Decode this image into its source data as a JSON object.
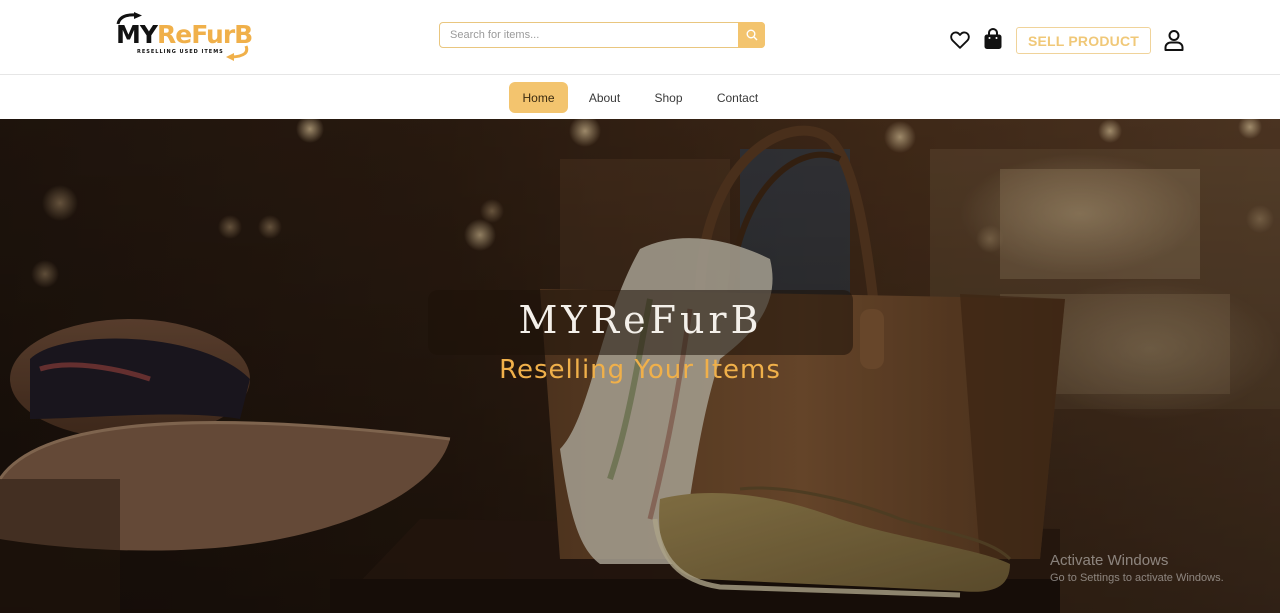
{
  "header": {
    "logo": {
      "text_my": "MY",
      "text_refurb": "ReFurB",
      "tagline": "RESELLING USED ITEMS"
    },
    "search": {
      "placeholder": "Search for items...",
      "value": "",
      "icon": "search-icon"
    },
    "wishlist_icon": "heart-icon",
    "cart_icon": "shopping-bag-icon",
    "sell_button_label": "SELL PRODUCT",
    "account_icon": "user-icon"
  },
  "nav": {
    "items": [
      {
        "label": "Home",
        "active": true
      },
      {
        "label": "About",
        "active": false
      },
      {
        "label": "Shop",
        "active": false
      },
      {
        "label": "Contact",
        "active": false
      }
    ]
  },
  "hero": {
    "title": "MYReFurB",
    "subtitle": "Reselling Your Items"
  },
  "watermark": {
    "title": "Activate Windows",
    "subtitle": "Go to Settings to activate Windows."
  },
  "colors": {
    "accent": "#f3c46e",
    "brand_orange": "#f0b04a",
    "text_dark": "#111111"
  }
}
